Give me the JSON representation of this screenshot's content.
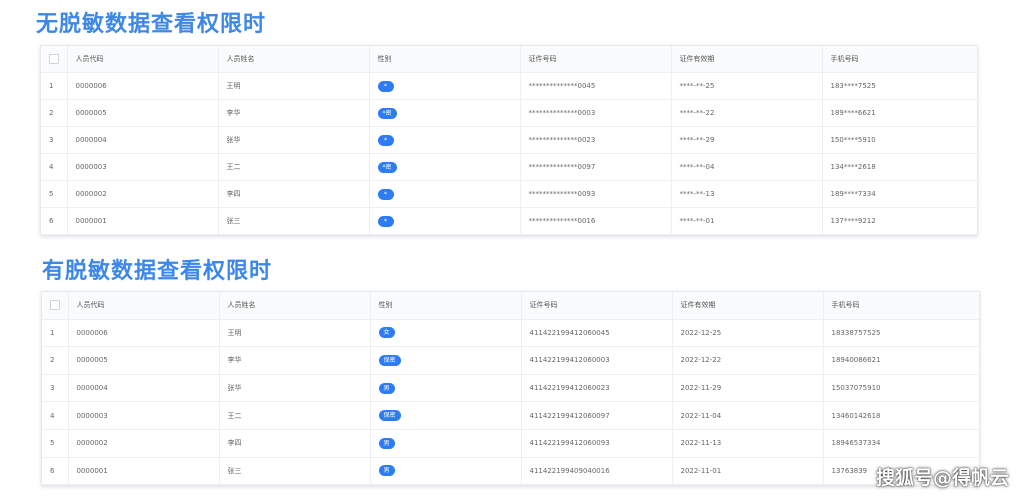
{
  "sections": [
    {
      "title": "无脱敏数据查看权限时",
      "columns": [
        "",
        "人员代码",
        "人员姓名",
        "性别",
        "证件号码",
        "证件有效期",
        "手机号码"
      ],
      "rows": [
        {
          "index": "1",
          "code": "0000006",
          "name": "王明",
          "gender": "*",
          "id_no": "**************0045",
          "validity": "****-**-25",
          "phone": "183****7525"
        },
        {
          "index": "2",
          "code": "0000005",
          "name": "李华",
          "gender": "*密",
          "id_no": "**************0003",
          "validity": "****-**-22",
          "phone": "189****6621"
        },
        {
          "index": "3",
          "code": "0000004",
          "name": "张华",
          "gender": "*",
          "id_no": "**************0023",
          "validity": "****-**-29",
          "phone": "150****5910"
        },
        {
          "index": "4",
          "code": "0000003",
          "name": "王二",
          "gender": "*密",
          "id_no": "**************0097",
          "validity": "****-**-04",
          "phone": "134****2618"
        },
        {
          "index": "5",
          "code": "0000002",
          "name": "李四",
          "gender": "*",
          "id_no": "**************0093",
          "validity": "****-**-13",
          "phone": "189****7334"
        },
        {
          "index": "6",
          "code": "0000001",
          "name": "张三",
          "gender": "*",
          "id_no": "**************0016",
          "validity": "****-**-01",
          "phone": "137****9212"
        }
      ]
    },
    {
      "title": "有脱敏数据查看权限时",
      "columns": [
        "",
        "人员代码",
        "人员姓名",
        "性别",
        "证件号码",
        "证件有效期",
        "手机号码"
      ],
      "rows": [
        {
          "index": "1",
          "code": "0000006",
          "name": "王明",
          "gender": "女",
          "id_no": "411422199412060045",
          "validity": "2022-12-25",
          "phone": "18338757525"
        },
        {
          "index": "2",
          "code": "0000005",
          "name": "李华",
          "gender": "保密",
          "id_no": "411422199412060003",
          "validity": "2022-12-22",
          "phone": "18940086621"
        },
        {
          "index": "3",
          "code": "0000004",
          "name": "张华",
          "gender": "男",
          "id_no": "411422199412060023",
          "validity": "2022-11-29",
          "phone": "15037075910"
        },
        {
          "index": "4",
          "code": "0000003",
          "name": "王二",
          "gender": "保密",
          "id_no": "411422199412060097",
          "validity": "2022-11-04",
          "phone": "13460142618"
        },
        {
          "index": "5",
          "code": "0000002",
          "name": "李四",
          "gender": "男",
          "id_no": "411422199412060093",
          "validity": "2022-11-13",
          "phone": "18946537334"
        },
        {
          "index": "6",
          "code": "0000001",
          "name": "张三",
          "gender": "男",
          "id_no": "411422199409040016",
          "validity": "2022-11-01",
          "phone": "13763839"
        }
      ]
    }
  ],
  "watermark": "搜狐号@得帆云",
  "colors": {
    "title": "#3d87e8",
    "badge": "#2d7cf6"
  }
}
